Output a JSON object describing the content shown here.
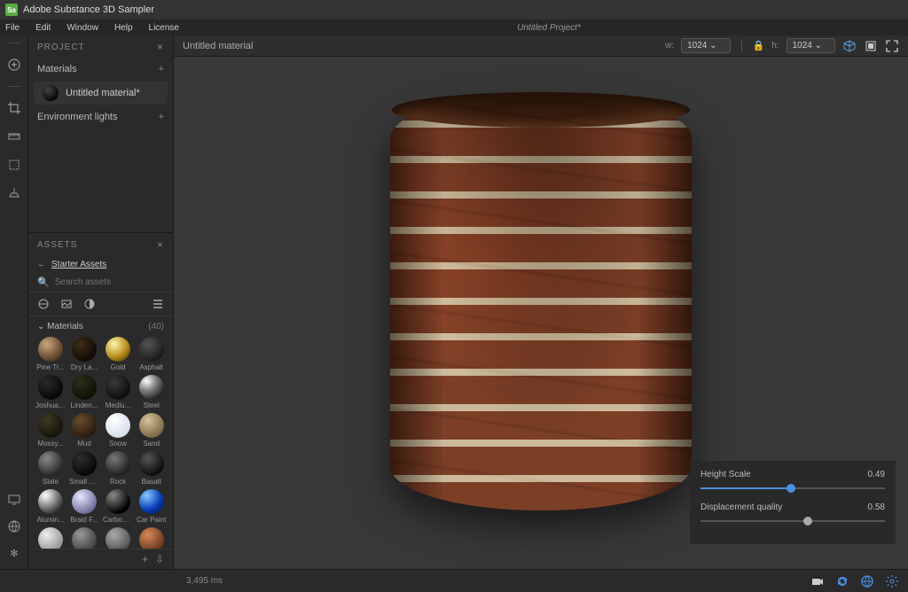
{
  "titlebar": {
    "app_name": "Adobe Substance 3D Sampler",
    "icon_label": "Sa"
  },
  "menubar": {
    "items": [
      "File",
      "Edit",
      "Window",
      "Help",
      "License"
    ],
    "project_name": "Untitled Project*"
  },
  "project_panel": {
    "title": "PROJECT",
    "sections": {
      "materials": "Materials",
      "env_lights": "Environment lights"
    },
    "current_material": "Untitled material*"
  },
  "assets_panel": {
    "title": "ASSETS",
    "breadcrumb_link": "Starter Assets",
    "search_placeholder": "Search assets",
    "category": {
      "name": "Materials",
      "count": "(40)"
    },
    "items": [
      {
        "label": "Pine Tr...",
        "bg": "radial-gradient(circle at 35% 30%, #caa57b, #4a321e 80%)"
      },
      {
        "label": "Dry La...",
        "bg": "radial-gradient(circle at 35% 30%, #3d2c18, #0c0804 80%)"
      },
      {
        "label": "Gold",
        "bg": "radial-gradient(circle at 35% 30%, #fff6b0, #b58a1a 55%, #3d2a05 95%)"
      },
      {
        "label": "Asphalt",
        "bg": "radial-gradient(circle at 35% 30%, #555, #111 85%)"
      },
      {
        "label": "Joshua ...",
        "bg": "radial-gradient(circle at 35% 30%, #2a2a2a, #000 85%)"
      },
      {
        "label": "Linden...",
        "bg": "radial-gradient(circle at 35% 30%, #2e2e1a, #0a0a04 85%)"
      },
      {
        "label": "Mediu...",
        "bg": "radial-gradient(circle at 35% 30%, #3a3a3a, #050505 85%)"
      },
      {
        "label": "Steel",
        "bg": "radial-gradient(circle at 30% 25%, #fff 0%, #888 35%, #000 90%)"
      },
      {
        "label": "Mossy...",
        "bg": "radial-gradient(circle at 35% 30%, #3d3a24, #0e0d06 85%)"
      },
      {
        "label": "Mud",
        "bg": "radial-gradient(circle at 35% 30%, #6a4b2c, #1f140a 85%)"
      },
      {
        "label": "Snow",
        "bg": "radial-gradient(circle at 35% 30%, #fff, #cfd8e4 85%)"
      },
      {
        "label": "Sand",
        "bg": "radial-gradient(circle at 35% 30%, #d8c39a, #6b5a3a 85%)"
      },
      {
        "label": "Slate",
        "bg": "radial-gradient(circle at 35% 30%, #888, #1a1a1a 85%)"
      },
      {
        "label": "Small G...",
        "bg": "radial-gradient(circle at 35% 30%, #2e2e2e, #000 85%)"
      },
      {
        "label": "Rock",
        "bg": "radial-gradient(circle at 35% 30%, #777, #111 85%)"
      },
      {
        "label": "Basalt",
        "bg": "radial-gradient(circle at 35% 30%, #555, #000 85%)"
      },
      {
        "label": "Alumin...",
        "bg": "radial-gradient(circle at 30% 25%, #fff, #666 55%, #000 95%)"
      },
      {
        "label": "Braid F...",
        "bg": "radial-gradient(circle at 35% 30%, #e6e6ff, #5a5a88 85%)"
      },
      {
        "label": "Carbon ...",
        "bg": "radial-gradient(circle at 30% 25%, #888 0%, #000 70%)"
      },
      {
        "label": "Car Paint",
        "bg": "radial-gradient(circle at 30% 25%, #87c9ff 0%, #0b3fb8 55%, #031142 95%)"
      },
      {
        "label": "",
        "bg": "radial-gradient(circle at 35% 30%, #eee, #888 85%)"
      },
      {
        "label": "",
        "bg": "radial-gradient(circle at 35% 30%, #999, #333 85%)"
      },
      {
        "label": "",
        "bg": "radial-gradient(circle at 35% 30%, #aaa, #444 85%)"
      },
      {
        "label": "",
        "bg": "radial-gradient(circle at 35% 30%, #d6885a, #5a2a14 85%)"
      }
    ]
  },
  "viewport": {
    "title": "Untitled material",
    "width_label": "w:",
    "width_value": "1024",
    "height_label": "h:",
    "height_value": "1024"
  },
  "controls": {
    "height_scale": {
      "label": "Height Scale",
      "value": "0.49",
      "pct": 49
    },
    "displacement": {
      "label": "Displacement quality",
      "value": "0.58",
      "pct": 58
    }
  },
  "status": {
    "render_time": "3,495 ms"
  }
}
